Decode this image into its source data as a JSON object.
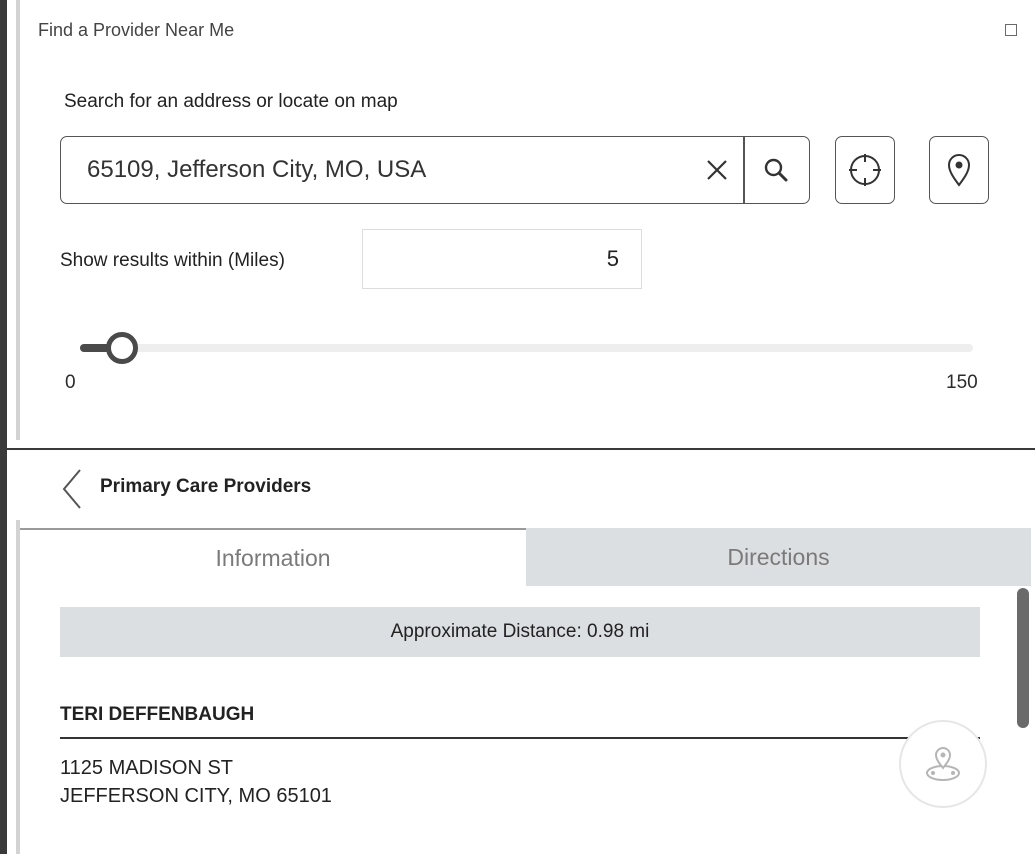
{
  "window": {
    "title": "Find a Provider Near Me"
  },
  "search": {
    "label": "Search for an address or locate on map",
    "value": "65109, Jefferson City, MO, USA"
  },
  "radius": {
    "label": "Show results within (Miles)",
    "value": "5",
    "slider_min": "0",
    "slider_max": "150",
    "slider_value": 5
  },
  "results": {
    "list_title": "Primary Care Providers",
    "tabs": [
      {
        "label": "Information",
        "active": true
      },
      {
        "label": "Directions",
        "active": false
      }
    ],
    "distance": "Approximate Distance: 0.98 mi",
    "provider": {
      "name": "TERI DEFFENBAUGH",
      "address_line1": "1125 MADISON ST",
      "address_line2": "JEFFERSON CITY, MO 65101"
    }
  },
  "icons": {
    "maximize": "maximize-icon",
    "clear": "close-icon",
    "search": "search-icon",
    "locate": "crosshair-icon",
    "pin": "map-pin-icon",
    "back": "chevron-left-icon",
    "route": "route-icon"
  },
  "colors": {
    "tab_inactive_bg": "#dcdfe2",
    "slider_fill": "#4a4a4a",
    "text": "#222222"
  }
}
